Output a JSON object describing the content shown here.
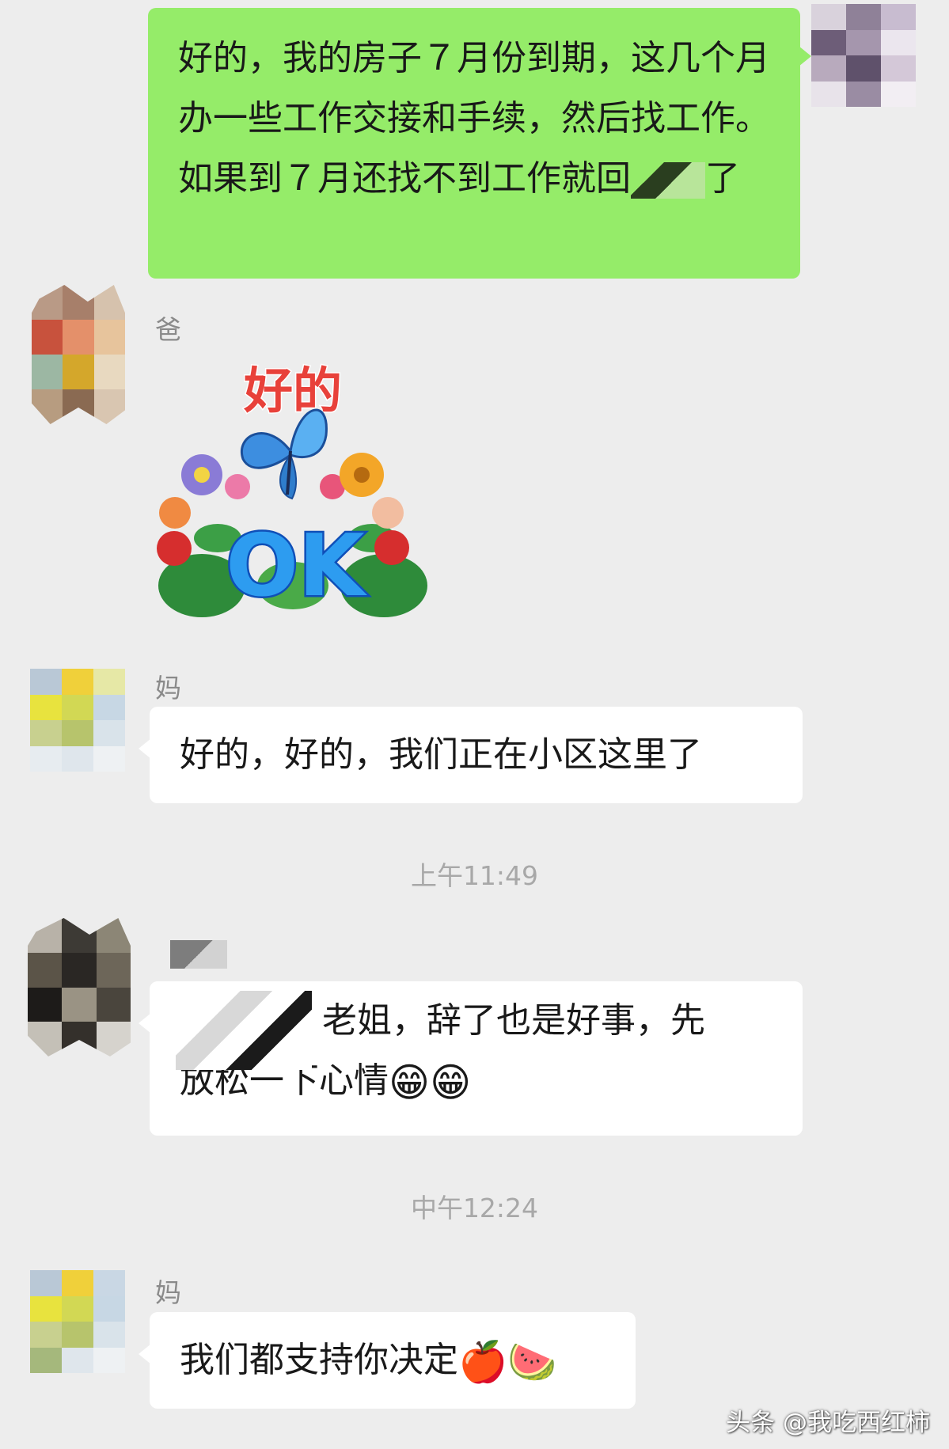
{
  "messages": {
    "m1": {
      "text_before": "好的，我的房子７月份到期，这几个月办一些工作交接和手续，然后找工作。如果到７月还找不到工作就回",
      "text_after": "了"
    },
    "m2": {
      "sender": "爸",
      "sticker_text": "好的",
      "sticker_ok": "OK"
    },
    "m3": {
      "sender": "妈",
      "text": "好的，好的，我们正在小区这里了"
    },
    "time1": "上午11:49",
    "m4": {
      "text_line1": "老姐，辞了也是好事，先",
      "text_line2": "放松一下心情",
      "emoji": "😁😁"
    },
    "time2": "中午12:24",
    "m5": {
      "sender": "妈",
      "text": "我们都支持你决定",
      "emoji": "🍎🍉"
    }
  },
  "watermark": "头条 @我吃西红柿",
  "colors": {
    "background": "#ededed",
    "my_bubble": "#95ec69",
    "other_bubble": "#ffffff",
    "time_text": "#a8a8a8"
  }
}
